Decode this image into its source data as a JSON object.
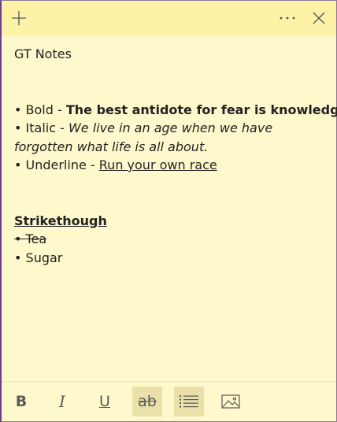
{
  "titlebar": {
    "add_icon": "plus-icon",
    "more_icon": "ellipsis-icon",
    "close_icon": "close-icon"
  },
  "note": {
    "title": "GT Notes",
    "bullet": "• ",
    "bold_line": {
      "prefix": "Bold - ",
      "text": "The best antidote for fear is knowledge"
    },
    "italic_line": {
      "prefix": "Italic - ",
      "text": "We live in an age when we have forgotten what life is all about."
    },
    "underline_line": {
      "prefix": "Underline - ",
      "text": "Run your own race"
    },
    "strike_heading": "Strikethough",
    "list": [
      "Tea",
      "Sugar"
    ]
  },
  "toolbar": {
    "bold_label": "B",
    "italic_label": "I",
    "underline_label": "U",
    "strike_label": "ab",
    "list_icon": "bullet-list-icon",
    "image_icon": "image-icon"
  },
  "colors": {
    "note_background": "#fef9cc",
    "titlebar_background": "#fdf2a6",
    "active_button": "#e9e1a9",
    "accent_border": "#6d3f7e"
  }
}
